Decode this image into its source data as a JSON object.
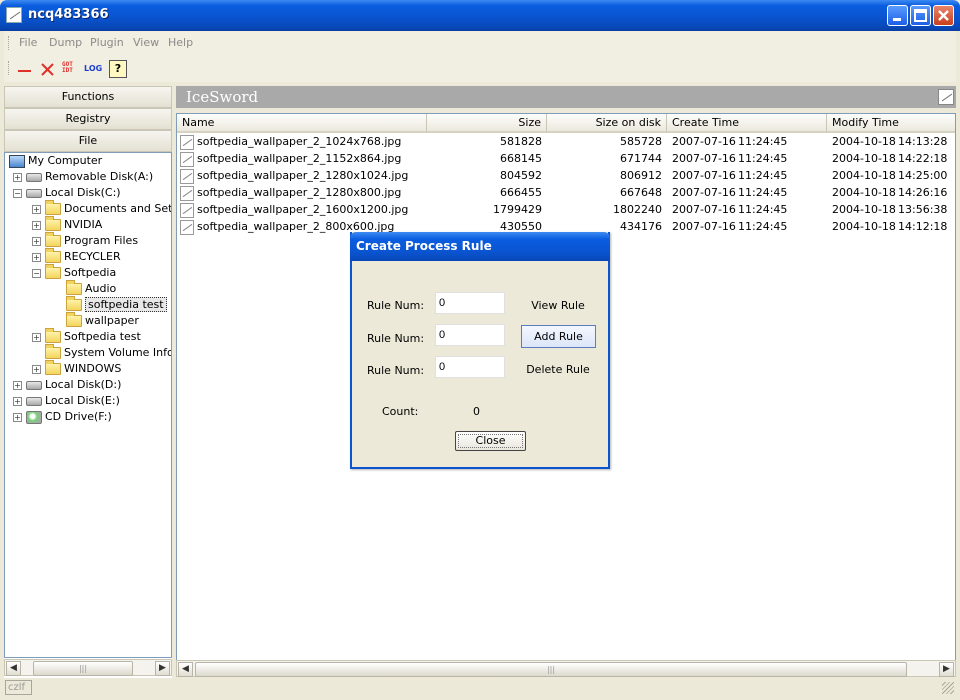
{
  "window": {
    "title": "ncq483366"
  },
  "menu": [
    "File",
    "Dump",
    "Plugin",
    "View",
    "Help"
  ],
  "toolbar": {
    "minus_icon": "minus-icon",
    "delete_icon": "red-x-icon",
    "got_label_top": "GOT",
    "got_label_bottom": "IDT",
    "log_label": "LOG",
    "help_glyph": "?"
  },
  "left": {
    "functions_label": "Functions",
    "registry_label": "Registry",
    "file_label": "File"
  },
  "tree": [
    {
      "label": "My Computer",
      "icon": "computer-icon"
    },
    {
      "label": "Removable Disk(A:)",
      "icon": "drive-icon"
    },
    {
      "label": "Local Disk(C:)",
      "icon": "drive-icon"
    },
    {
      "label": "Documents and Settings",
      "icon": "folder-icon"
    },
    {
      "label": "NVIDIA",
      "icon": "folder-icon"
    },
    {
      "label": "Program Files",
      "icon": "folder-icon"
    },
    {
      "label": "RECYCLER",
      "icon": "folder-icon"
    },
    {
      "label": "Softpedia",
      "icon": "folder-icon"
    },
    {
      "label": "Audio",
      "icon": "folder-icon"
    },
    {
      "label": "softpedia test",
      "icon": "folder-open-icon"
    },
    {
      "label": "wallpaper",
      "icon": "folder-icon"
    },
    {
      "label": "Softpedia test",
      "icon": "folder-icon"
    },
    {
      "label": "System Volume Information",
      "icon": "folder-icon"
    },
    {
      "label": "WINDOWS",
      "icon": "folder-icon"
    },
    {
      "label": "Local Disk(D:)",
      "icon": "drive-icon"
    },
    {
      "label": "Local Disk(E:)",
      "icon": "drive-icon"
    },
    {
      "label": "CD Drive(F:)",
      "icon": "cd-drive-icon"
    }
  ],
  "panel": {
    "title": "IceSword"
  },
  "columns": [
    "Name",
    "Size",
    "Size on disk",
    "Create Time",
    "Modify Time"
  ],
  "files": [
    {
      "name": "softpedia_wallpaper_2_1024x768.jpg",
      "size": "581828",
      "size_on_disk": "585728",
      "create_date": "2007-07-16",
      "create_time": "11:24:45",
      "modify_date": "2004-10-18",
      "modify_time": "14:13:28"
    },
    {
      "name": "softpedia_wallpaper_2_1152x864.jpg",
      "size": "668145",
      "size_on_disk": "671744",
      "create_date": "2007-07-16",
      "create_time": "11:24:45",
      "modify_date": "2004-10-18",
      "modify_time": "14:22:18"
    },
    {
      "name": "softpedia_wallpaper_2_1280x1024.jpg",
      "size": "804592",
      "size_on_disk": "806912",
      "create_date": "2007-07-16",
      "create_time": "11:24:45",
      "modify_date": "2004-10-18",
      "modify_time": "14:25:00"
    },
    {
      "name": "softpedia_wallpaper_2_1280x800.jpg",
      "size": "666455",
      "size_on_disk": "667648",
      "create_date": "2007-07-16",
      "create_time": "11:24:45",
      "modify_date": "2004-10-18",
      "modify_time": "14:26:16"
    },
    {
      "name": "softpedia_wallpaper_2_1600x1200.jpg",
      "size": "1799429",
      "size_on_disk": "1802240",
      "create_date": "2007-07-16",
      "create_time": "11:24:45",
      "modify_date": "2004-10-18",
      "modify_time": "13:56:38"
    },
    {
      "name": "softpedia_wallpaper_2_800x600.jpg",
      "size": "430550",
      "size_on_disk": "434176",
      "create_date": "2007-07-16",
      "create_time": "11:24:45",
      "modify_date": "2004-10-18",
      "modify_time": "14:12:18"
    }
  ],
  "dialog": {
    "title": "Create Process Rule",
    "rule_label": "Rule Num:",
    "rule_values": [
      "0",
      "0",
      "0"
    ],
    "view_rule": "View Rule",
    "add_rule": "Add Rule",
    "delete_rule": "Delete Rule",
    "count_label": "Count:",
    "count_value": "0",
    "close": "Close"
  },
  "status": {
    "text": "czlf"
  }
}
